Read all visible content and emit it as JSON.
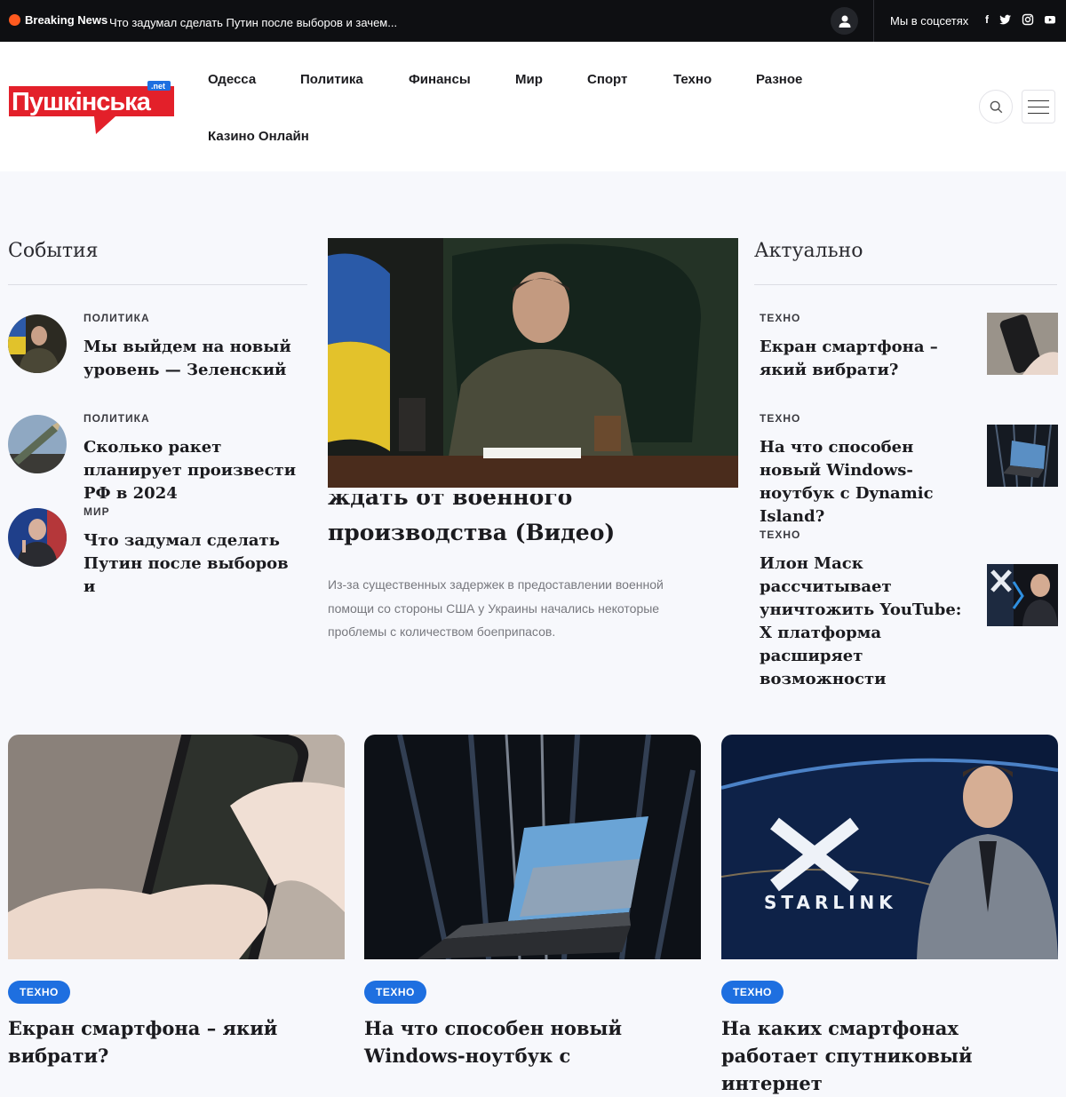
{
  "topbar": {
    "breaking_label": "Breaking News",
    "ticker_text": "Что задумал сделать Путин после выборов и зачем...",
    "social_label": "Мы в соцсетях",
    "icons": [
      "user-icon",
      "facebook-icon",
      "twitter-icon",
      "instagram-icon",
      "youtube-icon"
    ]
  },
  "header": {
    "logo_text": "Пушкінська",
    "logo_badge": ".net",
    "nav": [
      "Одесса",
      "Политика",
      "Финансы",
      "Мир",
      "Спорт",
      "Техно",
      "Разное",
      "Казино Онлайн"
    ]
  },
  "events": {
    "heading": "События",
    "items": [
      {
        "category": "ПОЛИТИКА",
        "title": "Мы выйдем на новый уровень — Зеленский"
      },
      {
        "category": "ПОЛИТИКА",
        "title": "Сколько ракет планирует произвести РФ в 2024"
      },
      {
        "category": "МИР",
        "title": "Что задумал сделать Путин после выборов и"
      }
    ]
  },
  "featured": {
    "title_line1": "ждать от военного",
    "title_line2": "производства (Видео)",
    "description": "Из-за существенных задержек в предоставлении военной помощи со стороны США у Украины начались некоторые проблемы с количеством боеприпасов."
  },
  "actual": {
    "heading": "Актуально",
    "items": [
      {
        "category": "ТЕХНО",
        "title": "Екран смартфона – який вибрати?"
      },
      {
        "category": "ТЕХНО",
        "title": "На что способен новый Windows-ноутбук с Dynamic Island?"
      },
      {
        "category": "ТЕХНО",
        "title": "Илон Маск рассчитывает уничтожить YouTube: X платформа расширяет возможности"
      }
    ]
  },
  "cards": [
    {
      "badge": "ТЕХНО",
      "title": "Екран смартфона – який вибрати?"
    },
    {
      "badge": "ТЕХНО",
      "title": "На что способен новый Windows-ноутбук с"
    },
    {
      "badge": "ТЕХНО",
      "title": "На каких смартфонах работает спутниковый интернет",
      "image_text": "STARLINK"
    }
  ],
  "colors": {
    "accent": "#1e6fe0",
    "logo_red": "#e3202a",
    "topbar": "#0e0f12"
  }
}
